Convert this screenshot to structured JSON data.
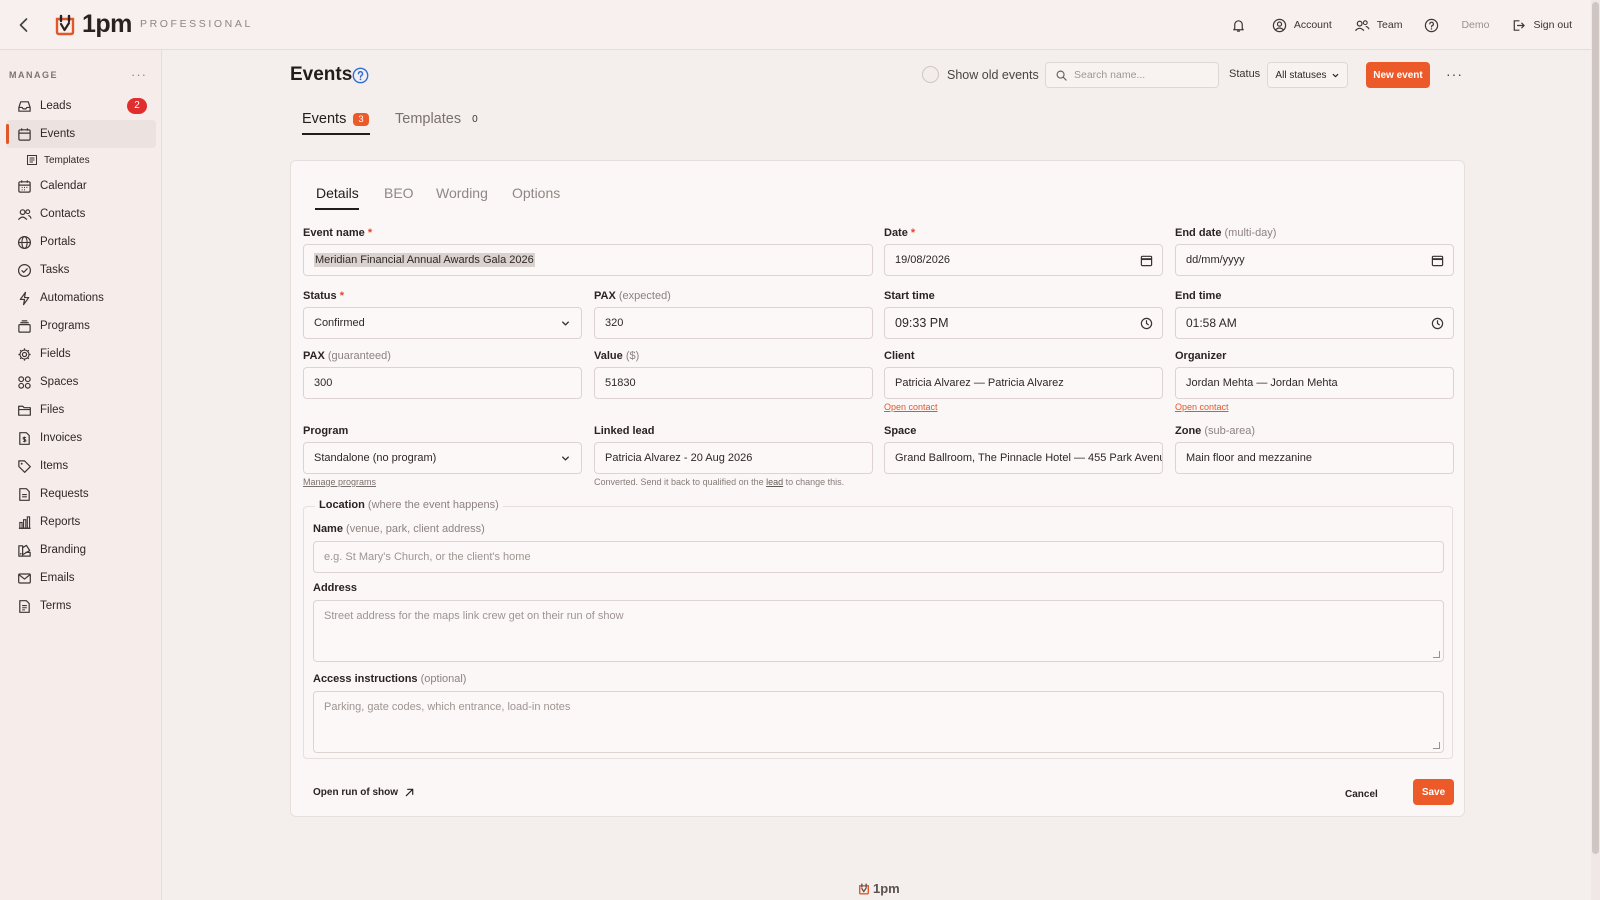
{
  "topbar": {
    "brand": "1pm",
    "edition": "PROFESSIONAL",
    "actions": [
      {
        "icon": "bell-icon",
        "label": ""
      },
      {
        "icon": "user-circle-icon",
        "label": "Account"
      },
      {
        "icon": "team-icon",
        "label": "Team"
      },
      {
        "icon": "help-circle-icon",
        "label": ""
      },
      {
        "icon": "",
        "label": "Demo"
      },
      {
        "icon": "sign-out-icon",
        "label": "Sign out"
      }
    ]
  },
  "sidebar": {
    "heading": "MANAGE",
    "more": "···",
    "items": [
      {
        "label": "Leads",
        "icon": "inbox-icon",
        "badge": "2"
      },
      {
        "label": "Events",
        "icon": "calendar-icon",
        "active": true
      },
      {
        "label": "Templates",
        "icon": "template-icon",
        "sub": true
      },
      {
        "label": "Calendar",
        "icon": "calendar-grid-icon"
      },
      {
        "label": "Contacts",
        "icon": "contacts-icon"
      },
      {
        "label": "Portals",
        "icon": "globe-icon"
      },
      {
        "label": "Tasks",
        "icon": "check-circle-icon"
      },
      {
        "label": "Automations",
        "icon": "lightning-icon"
      },
      {
        "label": "Programs",
        "icon": "stack-icon"
      },
      {
        "label": "Fields",
        "icon": "gear-icon"
      },
      {
        "label": "Spaces",
        "icon": "grid-icon"
      },
      {
        "label": "Files",
        "icon": "folder-icon"
      },
      {
        "label": "Invoices",
        "icon": "invoice-icon"
      },
      {
        "label": "Items",
        "icon": "tag-icon"
      },
      {
        "label": "Requests",
        "icon": "document-icon"
      },
      {
        "label": "Reports",
        "icon": "bar-chart-icon"
      },
      {
        "label": "Branding",
        "icon": "palette-icon"
      },
      {
        "label": "Emails",
        "icon": "mail-icon"
      },
      {
        "label": "Terms",
        "icon": "terms-icon"
      }
    ]
  },
  "header": {
    "title": "Events",
    "show_old_label": "Show old events",
    "search_placeholder": "Search name...",
    "status_label": "Status",
    "status_value": "All statuses",
    "new_event_label": "New event",
    "more": "···"
  },
  "page_tabs": [
    {
      "label": "Events",
      "count": "3",
      "active": true
    },
    {
      "label": "Templates",
      "count": "0"
    }
  ],
  "card_tabs": [
    "Details",
    "BEO",
    "Wording",
    "Options"
  ],
  "form": {
    "event_name": {
      "label": "Event name",
      "required": "*",
      "value": "Meridian Financial Annual Awards Gala 2026"
    },
    "date": {
      "label": "Date",
      "required": "*",
      "value": "19/08/2026"
    },
    "end_date": {
      "label": "End date",
      "hint": "(multi-day)",
      "value": "dd/mm/yyyy"
    },
    "status": {
      "label": "Status",
      "required": "*",
      "value": "Confirmed"
    },
    "pax_expected": {
      "label": "PAX",
      "hint": "(expected)",
      "value": "320"
    },
    "start_time": {
      "label": "Start time",
      "value": "09:33 PM"
    },
    "end_time": {
      "label": "End time",
      "value": "01:58 AM"
    },
    "pax_guaranteed": {
      "label": "PAX",
      "hint": "(guaranteed)",
      "value": "300"
    },
    "value": {
      "label": "Value",
      "hint": "($)",
      "value": "51830"
    },
    "client": {
      "label": "Client",
      "value": "Patricia Alvarez — Patricia Alvarez",
      "link": "Open contact"
    },
    "organizer": {
      "label": "Organizer",
      "value": "Jordan Mehta — Jordan Mehta",
      "link": "Open contact"
    },
    "program": {
      "label": "Program",
      "value": "Standalone (no program)",
      "link": "Manage programs"
    },
    "linked_lead": {
      "label": "Linked lead",
      "value": "Patricia Alvarez - 20 Aug 2026",
      "note_prefix": "Converted. Send it back to qualified on the ",
      "note_link": "lead",
      "note_suffix": " to change this."
    },
    "space": {
      "label": "Space",
      "value": "Grand Ballroom, The Pinnacle Hotel — 455 Park Avenu"
    },
    "zone": {
      "label": "Zone",
      "hint": "(sub-area)",
      "value": "Main floor and mezzanine"
    },
    "location": {
      "legend": "Location",
      "legend_hint": "(where the event happens)",
      "name": {
        "label": "Name",
        "hint": "(venue, park, client address)",
        "placeholder": "e.g. St Mary's Church, or the client's home"
      },
      "address": {
        "label": "Address",
        "placeholder": "Street address for the maps link crew get on their run of show"
      },
      "access": {
        "label": "Access instructions",
        "hint": "(optional)",
        "placeholder": "Parking, gate codes, which entrance, load-in notes"
      }
    },
    "run_of_show_label": "Open run of show",
    "cancel_label": "Cancel",
    "save_label": "Save"
  },
  "footer": {
    "brand": "1pm"
  },
  "colors": {
    "accent": "#ec5a2a",
    "badge": "#e02d2d",
    "help": "#2e6fd6"
  }
}
